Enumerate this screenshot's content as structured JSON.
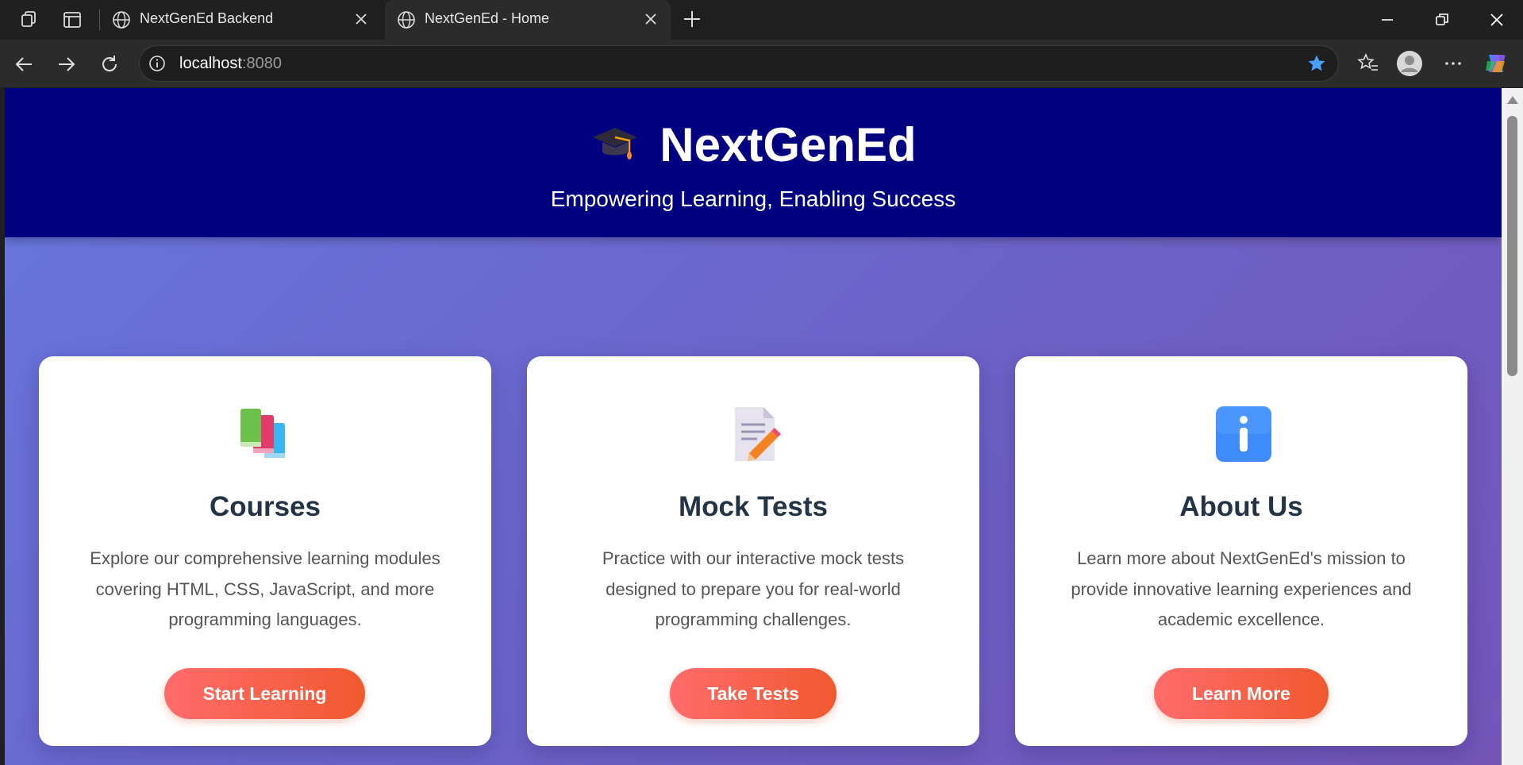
{
  "browser": {
    "tabs": [
      {
        "title": "NextGenEd Backend",
        "active": false
      },
      {
        "title": "NextGenEd - Home",
        "active": true
      }
    ],
    "address": {
      "host": "localhost",
      "port": ":8080"
    },
    "favorited": true
  },
  "hero": {
    "brand": "NextGenEd",
    "brand_icon": "graduation-cap-icon",
    "tagline": "Empowering Learning, Enabling Success",
    "background": "#000080"
  },
  "cards": [
    {
      "icon": "books-icon",
      "title": "Courses",
      "text": "Explore our comprehensive learning modules covering HTML, CSS, JavaScript, and more programming languages.",
      "button": "Start Learning"
    },
    {
      "icon": "memo-icon",
      "title": "Mock Tests",
      "text": "Practice with our interactive mock tests designed to prepare you for real-world programming challenges.",
      "button": "Take Tests"
    },
    {
      "icon": "information-icon",
      "title": "About Us",
      "text": "Learn more about NextGenEd's mission to provide innovative learning experiences and academic excellence.",
      "button": "Learn More"
    }
  ],
  "colors": {
    "accent_button_start": "#ff6b6b",
    "accent_button_end": "#f0592f",
    "heading": "#243447",
    "body_text": "#555555"
  }
}
